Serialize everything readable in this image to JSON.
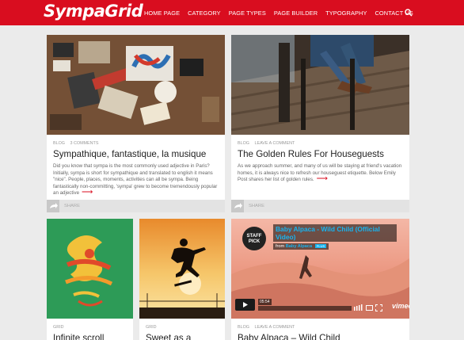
{
  "header": {
    "logo": "SympaGrid",
    "nav": [
      "HOME PAGE",
      "CATEGORY",
      "PAGE TYPES",
      "PAGE BUILDER",
      "TYPOGRAPHY",
      "CONTACT US"
    ],
    "search_icon": "search-icon",
    "brand_color": "#d90d1f"
  },
  "posts": [
    {
      "meta": [
        "BLOG",
        "3 COMMENTS"
      ],
      "title": "Sympathique, fantastique, la musique",
      "excerpt": "Did you know that sympa is the most commonly used adjective in Paris? Initially, sympa is short for sympathique and translated to english it means \"nice\". People, places, moments, activities can all be sympa. Being fantastically non-committing, 'sympa' grew to become tremendously popular an adjective",
      "more": "⟶",
      "share": "SHARE"
    },
    {
      "meta": [
        "BLOG",
        "LEAVE A COMMENT"
      ],
      "title": "The Golden Rules For Houseguests",
      "excerpt": "As we approach summer, and many of us will be staying at friend's vacation homes, it is always nice to refresh our houseguest etiquette. Below Emily Post shares her list of golden rules.",
      "more": "⟶",
      "share": "SHARE"
    },
    {
      "meta": [
        "GRID"
      ],
      "title": "Infinite scroll"
    },
    {
      "meta": [
        "GRID"
      ],
      "title": "Sweet as a"
    },
    {
      "meta": [
        "BLOG",
        "LEAVE A COMMENT"
      ],
      "title": "Baby Alpaca – Wild Child",
      "video": {
        "title": "Baby Alpaca - Wild Child (Official Video)",
        "from_label": "from",
        "from": "Baby Alpaca",
        "plus": "PLUS",
        "badge": [
          "vimeo",
          "STAFF",
          "PICK"
        ],
        "time": "05:54",
        "logo": "vimeo"
      }
    }
  ]
}
